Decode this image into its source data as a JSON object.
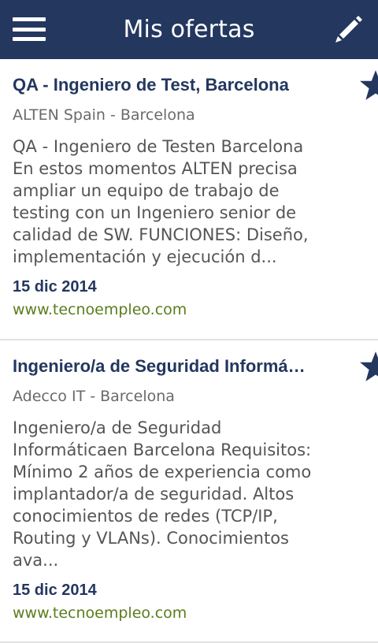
{
  "app_bar": {
    "title": "Mis ofertas",
    "menu_icon": "hamburger-menu-icon",
    "edit_icon": "pencil-icon",
    "background": "#23375f"
  },
  "offers": [
    {
      "title": "QA - Ingeniero de Test, Barcelona",
      "company": "ALTEN Spain - Barcelona",
      "description": "QA - Ingeniero de Testen Barcelona En estos momentos ALTEN precisa ampliar un equipo de trabajo de testing con un Ingeniero senior de calidad de SW. FUNCIONES: Diseño, implementación y ejecución d...",
      "date": "15 dic 2014",
      "source": "www.tecnoempleo.com",
      "favorite": true
    },
    {
      "title": "Ingeniero/a de Seguridad Informá…",
      "company": "Adecco IT - Barcelona",
      "description": "Ingeniero/a de Seguridad Informáticaen Barcelona Requisitos: Mínimo 2 años de experiencia como implantador/a de seguridad. Altos conocimientos de redes (TCP/IP, Routing y VLANs). Conocimientos ava...",
      "date": "15 dic 2014",
      "source": "www.tecnoempleo.com",
      "favorite": true
    }
  ],
  "colors": {
    "accent": "#23375f",
    "source_link": "#5a7d1c",
    "company_text": "#6a6a6a",
    "body_text": "#555555"
  }
}
